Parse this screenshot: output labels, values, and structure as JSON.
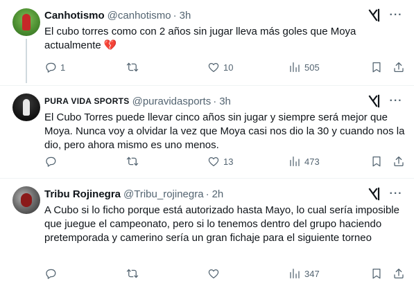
{
  "tweets": [
    {
      "name": "Canhotismo",
      "handle": "@canhotismo",
      "separator": "·",
      "time": "3h",
      "text": "El cubo torres como con 2 años sin jugar lleva más goles que Moya actualmente 💔",
      "replies": "1",
      "retweets": "",
      "likes": "10",
      "views": "505"
    },
    {
      "name": "PURA VIDA SPORTS",
      "handle": "@puravidasports",
      "separator": "·",
      "time": "3h",
      "text": "El Cubo Torres puede llevar cinco años sin jugar y siempre será mejor que Moya. Nunca voy a olvidar la vez que Moya casi nos dio la 30 y cuando nos la dio, pero ahora mismo es uno menos.",
      "replies": "",
      "retweets": "",
      "likes": "13",
      "views": "473"
    },
    {
      "name": "Tribu Rojinegra",
      "handle": "@Tribu_rojinegra",
      "separator": "·",
      "time": "2h",
      "text": "A Cubo si lo ficho porque está autorizado hasta Mayo, lo cual sería imposible que juegue el campeonato, pero si lo tenemos dentro del grupo haciendo pretemporada y camerino sería un gran fichaje para el siguiente torneo",
      "replies": "",
      "retweets": "",
      "likes": "",
      "views": "347"
    }
  ],
  "icons": {
    "reply": "reply-icon",
    "retweet": "retweet-icon",
    "like": "heart-icon",
    "views": "views-chart-icon",
    "bookmark": "bookmark-icon",
    "share": "share-icon",
    "grok": "grok-icon",
    "more": "more-icon"
  },
  "colors": {
    "text": "#0f1419",
    "secondary": "#536471",
    "divider": "#eff3f4",
    "thread_line": "#cfd9de"
  }
}
